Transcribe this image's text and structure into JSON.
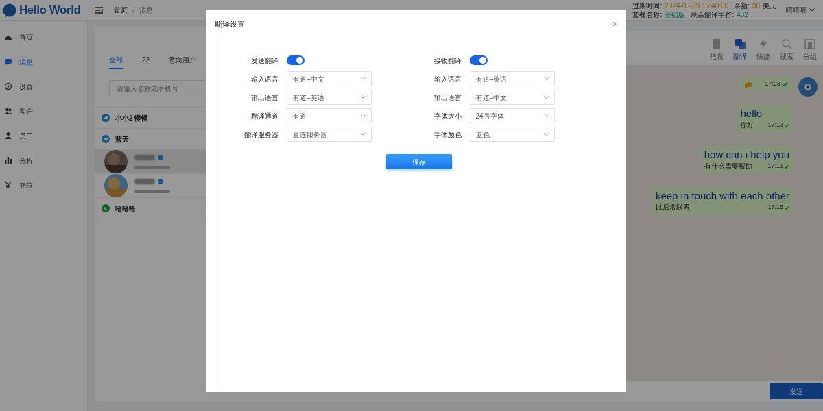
{
  "logo": {
    "text": "Hello World"
  },
  "breadcrumb": [
    "首页",
    "消息"
  ],
  "account": {
    "expire_label": "过期时间:",
    "expire_value": "2024-03-09 15:40:00",
    "balance_label": "余额:",
    "balance_value": "$0",
    "balance_unit": "美元",
    "plan_label": "套餐名称:",
    "plan_value": "基础版",
    "chars_label": "剩余翻译字符:",
    "chars_value": "402",
    "user": "嘻嘻嘻"
  },
  "sidebar": {
    "items": [
      {
        "label": "首页",
        "selected": false
      },
      {
        "label": "消息",
        "selected": true
      },
      {
        "label": "设置",
        "selected": false
      },
      {
        "label": "客户",
        "selected": false
      },
      {
        "label": "员工",
        "selected": false
      },
      {
        "label": "分析",
        "selected": false
      },
      {
        "label": "充值",
        "selected": false
      }
    ]
  },
  "contacts": {
    "tabs": [
      {
        "label": "全部",
        "selected": true
      },
      {
        "label": "22",
        "selected": false
      },
      {
        "label": "意向用户",
        "selected": false
      }
    ],
    "search": {
      "placeholder": "请输入名称或手机号"
    },
    "items": [
      {
        "kind": "telegram",
        "name": "小小2 慢慢",
        "selected": false
      },
      {
        "kind": "telegram",
        "name": "蓝天",
        "selected": false
      },
      {
        "kind": "blurred",
        "selected": true
      },
      {
        "kind": "blurred",
        "selected": false
      },
      {
        "kind": "whatsapp",
        "name": "哈哈哈",
        "selected": false
      }
    ]
  },
  "chat": {
    "tools": [
      {
        "label": "信息",
        "selected": false
      },
      {
        "label": "翻译",
        "selected": true
      },
      {
        "label": "快捷",
        "selected": false
      },
      {
        "label": "搜索",
        "selected": false
      },
      {
        "label": "分组",
        "selected": false
      }
    ],
    "messages": [
      {
        "kind": "emoji",
        "time": "17:23",
        "read": true
      },
      {
        "kind": "text",
        "text": "hello",
        "translation": "你好",
        "time": "17:13",
        "read": false
      },
      {
        "kind": "text",
        "text": "how can i help you",
        "translation": "有什么需要帮助",
        "time": "17:13",
        "read": false
      },
      {
        "kind": "text",
        "text": "keep in touch with each other",
        "translation": "以后常联系",
        "time": "17:15",
        "read": false
      }
    ],
    "send_button": "发送"
  },
  "dialog": {
    "title": "翻译设置",
    "close": "×",
    "columns": [
      [
        {
          "kind": "switch",
          "label": "发送翻译",
          "on": true
        },
        {
          "kind": "select",
          "label": "输入语言",
          "value": "有道–中文"
        },
        {
          "kind": "select",
          "label": "输出语言",
          "value": "有道–英语"
        },
        {
          "kind": "select",
          "label": "翻译通道",
          "value": "有道"
        },
        {
          "kind": "select",
          "label": "翻译服务器",
          "value": "直连服务器"
        }
      ],
      [
        {
          "kind": "switch",
          "label": "接收翻译",
          "on": true
        },
        {
          "kind": "select",
          "label": "输入语言",
          "value": "有道–英语"
        },
        {
          "kind": "select",
          "label": "输出语言",
          "value": "有道–中文"
        },
        {
          "kind": "select",
          "label": "字体大小",
          "value": "24号字体"
        },
        {
          "kind": "select",
          "label": "字体颜色",
          "value": "蓝色"
        }
      ]
    ],
    "save_button": "保存"
  }
}
